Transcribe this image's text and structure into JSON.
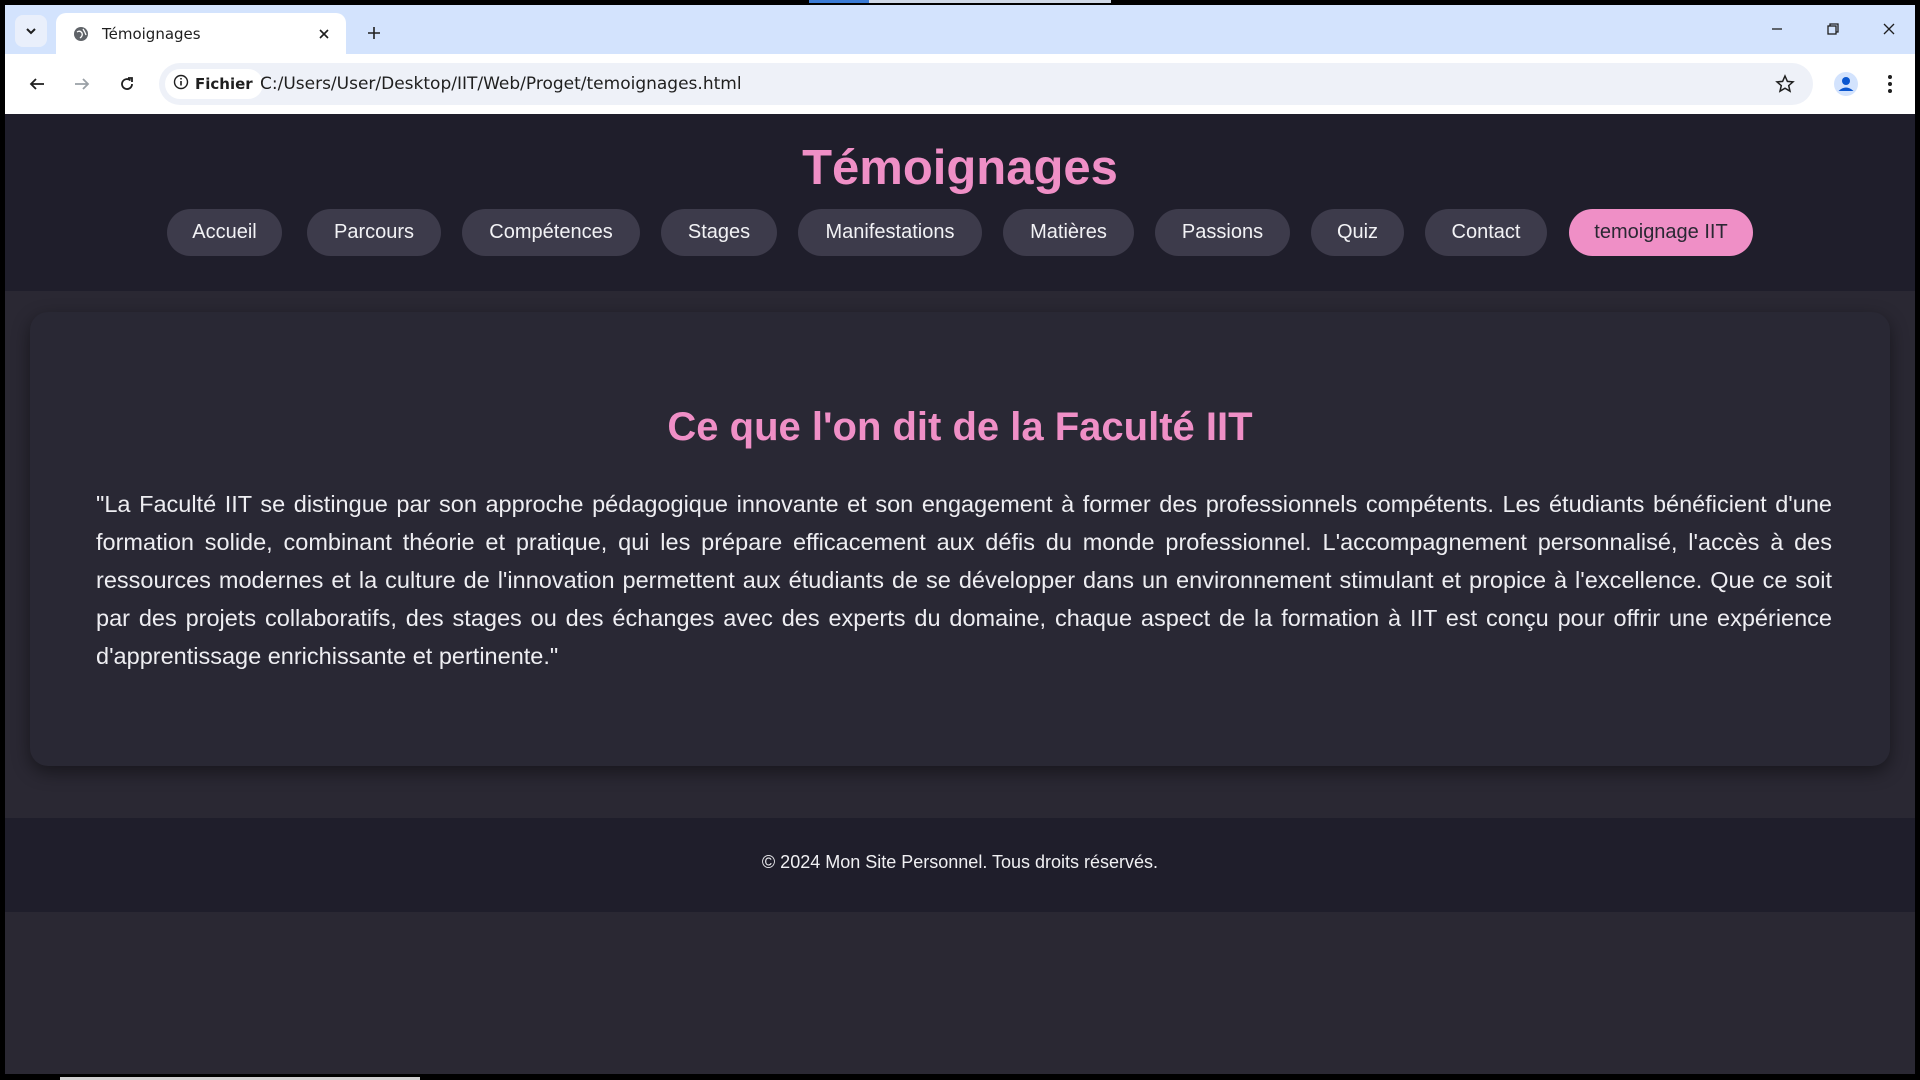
{
  "browser": {
    "tab_title": "Témoignages",
    "chip_label": "Fichier",
    "url": "C:/Users/User/Desktop/IIT/Web/Proget/temoignages.html",
    "icons": [
      "tab-search-icon",
      "globe-icon",
      "close-icon",
      "plus-icon",
      "minimize-icon",
      "restore-icon",
      "close-window-icon",
      "back-arrow-icon",
      "forward-arrow-icon",
      "reload-icon",
      "info-icon",
      "star-icon",
      "profile-icon",
      "kebab-menu-icon"
    ]
  },
  "site": {
    "title": "Témoignages",
    "nav": [
      {
        "label": "Accueil",
        "active": false
      },
      {
        "label": "Parcours",
        "active": false
      },
      {
        "label": "Compétences",
        "active": false
      },
      {
        "label": "Stages",
        "active": false
      },
      {
        "label": "Manifestations",
        "active": false
      },
      {
        "label": "Matières",
        "active": false
      },
      {
        "label": "Passions",
        "active": false
      },
      {
        "label": "Quiz",
        "active": false
      },
      {
        "label": "Contact",
        "active": false
      },
      {
        "label": "temoignage IIT",
        "active": true
      }
    ],
    "section_title": "Ce que l'on dit de la Faculté IIT",
    "quote": "\"La Faculté IIT se distingue par son approche pédagogique innovante et son engagement à former des professionnels compétents. Les étudiants bénéficient d'une formation solide, combinant théorie et pratique, qui les prépare efficacement aux défis du monde professionnel. L'accompagnement personnalisé, l'accès à des ressources modernes et la culture de l'innovation permettent aux étudiants de se développer dans un environnement stimulant et propice à l'excellence. Que ce soit par des projets collaboratifs, des stages ou des échanges avec des experts du domaine, chaque aspect de la formation à IIT est conçu pour offrir une expérience d'apprentissage enrichissante et pertinente.\"",
    "footer": "© 2024 Mon Site Personnel. Tous droits réservés."
  },
  "colors": {
    "accent": "#ef8fc6",
    "header_bg": "#1f1e2b",
    "page_bg": "#2a2833",
    "pill_bg": "#3d3b4b",
    "tabstrip_bg": "#d3e3fd"
  }
}
